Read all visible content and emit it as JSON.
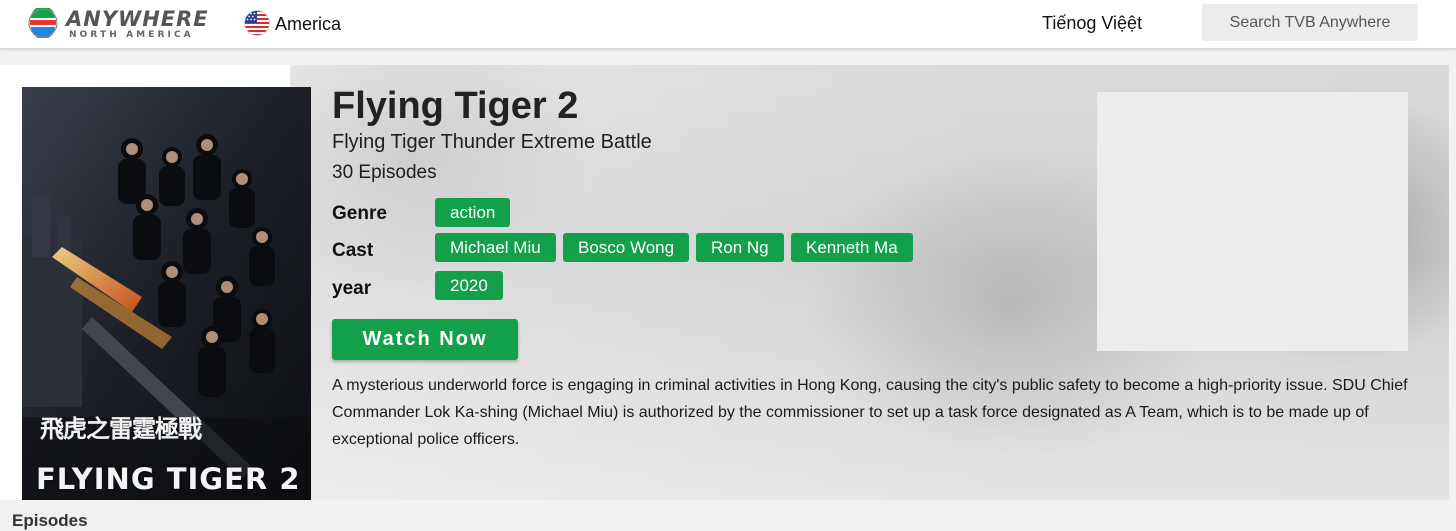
{
  "header": {
    "logo_text": "ANYWHERE",
    "logo_subtext": "NORTH AMERICA",
    "region_label": "America",
    "language_label": "Tiếnog Việệt",
    "search_placeholder": "Search TVB Anywhere"
  },
  "show": {
    "poster_title": "FLYING TIGER 2",
    "poster_chinese_title": "飛虎之雷霆極戰",
    "title": "Flying Tiger 2",
    "subtitle": "Flying Tiger Thunder Extreme Battle",
    "episodes": "30 Episodes",
    "genre_label": "Genre",
    "genres": [
      "action"
    ],
    "cast_label": "Cast",
    "cast": [
      "Michael Miu",
      "Bosco Wong",
      "Ron Ng",
      "Kenneth Ma"
    ],
    "year_label": "year",
    "year": "2020",
    "watch_button": "Watch Now",
    "description": "A mysterious underworld force is engaging in criminal activities in Hong Kong, causing the city's public safety to become a high-priority issue. SDU Chief Commander Lok Ka-shing (Michael Miu) is authorized by the commissioner to set up a task force designated as A Team, which is to be made up of exceptional police officers."
  },
  "next_section_peek": "Episodes",
  "colors": {
    "accent_green": "#13a04a",
    "topbar_bg": "#ffffff",
    "page_bg": "#f1f1f1",
    "ad_placeholder": "#ececec"
  },
  "icons": {
    "logo": "tvb-logo-icon",
    "flag": "us-flag-icon"
  }
}
